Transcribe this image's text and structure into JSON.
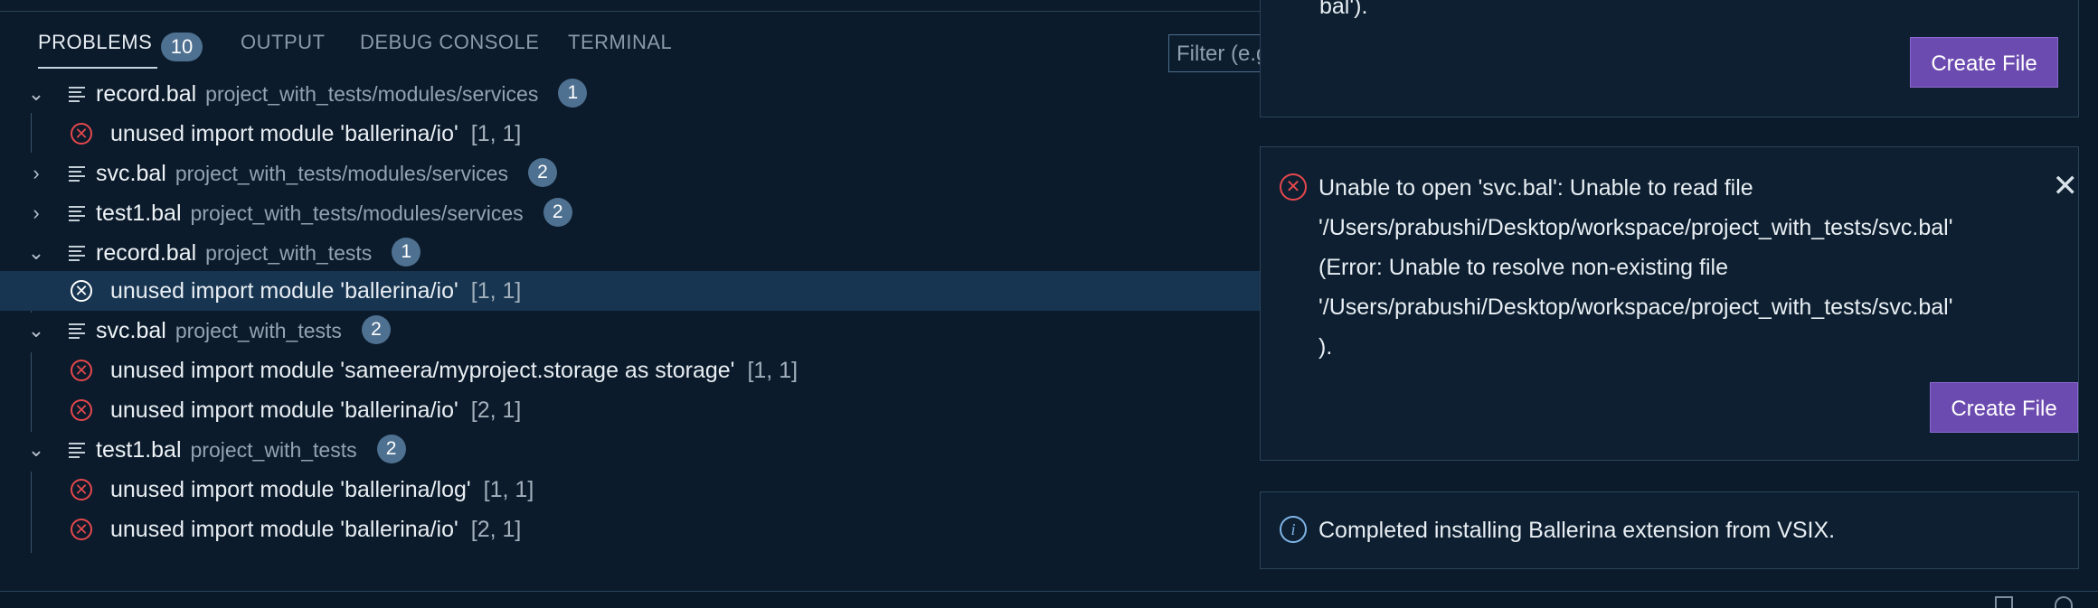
{
  "panel": {
    "tabs": [
      {
        "label": "PROBLEMS"
      },
      {
        "label": "OUTPUT"
      },
      {
        "label": "DEBUG CONSOLE"
      },
      {
        "label": "TERMINAL"
      }
    ],
    "problems_count": "10",
    "filter_placeholder": "Filter (e.g."
  },
  "problems": [
    {
      "file": "record.bal",
      "path": "project_with_tests/modules/services",
      "count": "1",
      "expanded": true,
      "items": [
        {
          "message": "unused import module 'ballerina/io'",
          "loc": "[1, 1]"
        }
      ]
    },
    {
      "file": "svc.bal",
      "path": "project_with_tests/modules/services",
      "count": "2",
      "expanded": false,
      "items": []
    },
    {
      "file": "test1.bal",
      "path": "project_with_tests/modules/services",
      "count": "2",
      "expanded": false,
      "items": []
    },
    {
      "file": "record.bal",
      "path": "project_with_tests",
      "count": "1",
      "expanded": true,
      "items": [
        {
          "message": "unused import module 'ballerina/io'",
          "loc": "[1, 1]"
        }
      ]
    },
    {
      "file": "svc.bal",
      "path": "project_with_tests",
      "count": "2",
      "expanded": true,
      "items": [
        {
          "message": "unused import module 'sameera/myproject.storage as storage'",
          "loc": "[1, 1]"
        },
        {
          "message": "unused import module 'ballerina/io'",
          "loc": "[2, 1]"
        }
      ]
    },
    {
      "file": "test1.bal",
      "path": "project_with_tests",
      "count": "2",
      "expanded": true,
      "items": [
        {
          "message": "unused import module 'ballerina/log'",
          "loc": "[1, 1]"
        },
        {
          "message": "unused import module 'ballerina/io'",
          "loc": "[2, 1]"
        }
      ]
    }
  ],
  "notifications": {
    "top": {
      "text_tail": "bal').",
      "button": "Create File"
    },
    "error": {
      "lines": [
        "Unable to open 'svc.bal': Unable to read file",
        "'/Users/prabushi/Desktop/workspace/project_with_tests/svc.bal'",
        "(Error: Unable to resolve non-existing file",
        "'/Users/prabushi/Desktop/workspace/project_with_tests/svc.bal'",
        ")."
      ],
      "button": "Create File"
    },
    "info": {
      "text": "Completed installing Ballerina extension from VSIX."
    }
  },
  "colors": {
    "error": "#e5484d",
    "info": "#7fb5e8",
    "button": "#6c4bb0",
    "selection": "#173551"
  }
}
